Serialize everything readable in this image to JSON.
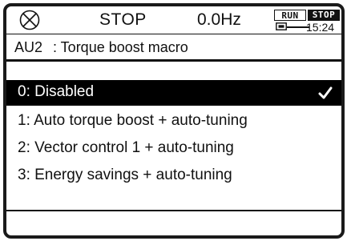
{
  "status": {
    "alarm_icon": "circle-x-icon",
    "mode": "STOP",
    "frequency": "0.0Hz",
    "run_label": "RUN",
    "stop_label": "STOP",
    "time": "15:24",
    "cassette_icon": "panel-cassette-icon"
  },
  "header": {
    "code": "AU2",
    "title": ": Torque boost macro"
  },
  "options": [
    {
      "label": "0: Disabled",
      "selected": true
    },
    {
      "label": "1: Auto torque boost + auto-tuning",
      "selected": false
    },
    {
      "label": "2: Vector control 1 + auto-tuning",
      "selected": false
    },
    {
      "label": "3: Energy savings + auto-tuning",
      "selected": false
    }
  ],
  "colors": {
    "foreground": "#111111",
    "highlight": "#000000",
    "background": "#ffffff"
  }
}
